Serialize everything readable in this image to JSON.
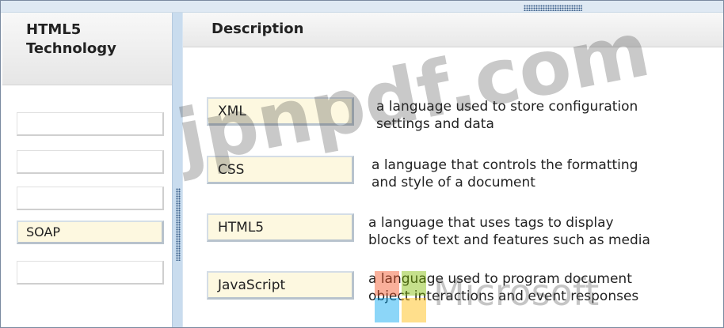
{
  "left_panel": {
    "title": "HTML5\nTechnology",
    "slots": [
      "",
      "",
      "",
      "SOAP",
      ""
    ]
  },
  "right_panel": {
    "title": "Description",
    "rows": [
      {
        "tech": "XML",
        "description_line1": "a language used to store configuration",
        "description_line2": "settings and data"
      },
      {
        "tech": "CSS",
        "description_line1": "a language that controls the formatting",
        "description_line2": "and style of a document"
      },
      {
        "tech": "HTML5",
        "description_line1": "a language that uses tags to display",
        "description_line2": "blocks of text and features such as media"
      },
      {
        "tech": "JavaScript",
        "description_line1": "a language used to program document",
        "description_line2": "object interactions and event responses"
      }
    ]
  },
  "watermarks": {
    "site": "jpnpdf.com",
    "brand": "Microsoft"
  },
  "colors": {
    "header_bg": "#e8e8e8",
    "splitter": "#c9dcee",
    "box_fill": "#fdf8e0",
    "ms_red": "#f25022",
    "ms_green": "#7fba00",
    "ms_blue": "#00a4ef",
    "ms_yellow": "#ffb900"
  }
}
